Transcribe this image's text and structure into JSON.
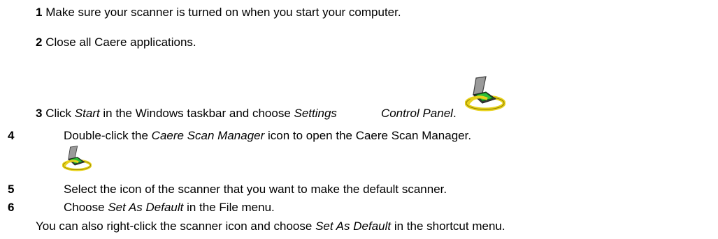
{
  "steps": [
    {
      "number": "1",
      "parts": [
        "Make sure your scanner is turned on when you start your computer."
      ]
    },
    {
      "number": "2",
      "parts": [
        "Close all Caere applications."
      ]
    },
    {
      "number": "3",
      "parts": [
        "Click ",
        "Start",
        " in the Windows taskbar and choose ",
        "Settings",
        "Control Panel",
        "."
      ]
    },
    {
      "number": "4",
      "parts": [
        "Double-click the ",
        "Caere Scan Manager",
        "  icon to open the Caere Scan Manager."
      ]
    },
    {
      "number": "5",
      "parts": [
        "Select the icon of the scanner that you want to make the default scanner."
      ]
    },
    {
      "number": "6",
      "parts": [
        "Choose ",
        "Set As Default",
        " in the File menu."
      ]
    }
  ],
  "note": {
    "parts": [
      "You can also right-click the scanner icon and choose ",
      "Set As Default",
      " in the shortcut menu."
    ]
  },
  "icons": {
    "scanner": "scanner-icon",
    "frame_color": "#808080",
    "glass_color": "#2fbf3a",
    "ring_color": "#e8d21a"
  }
}
